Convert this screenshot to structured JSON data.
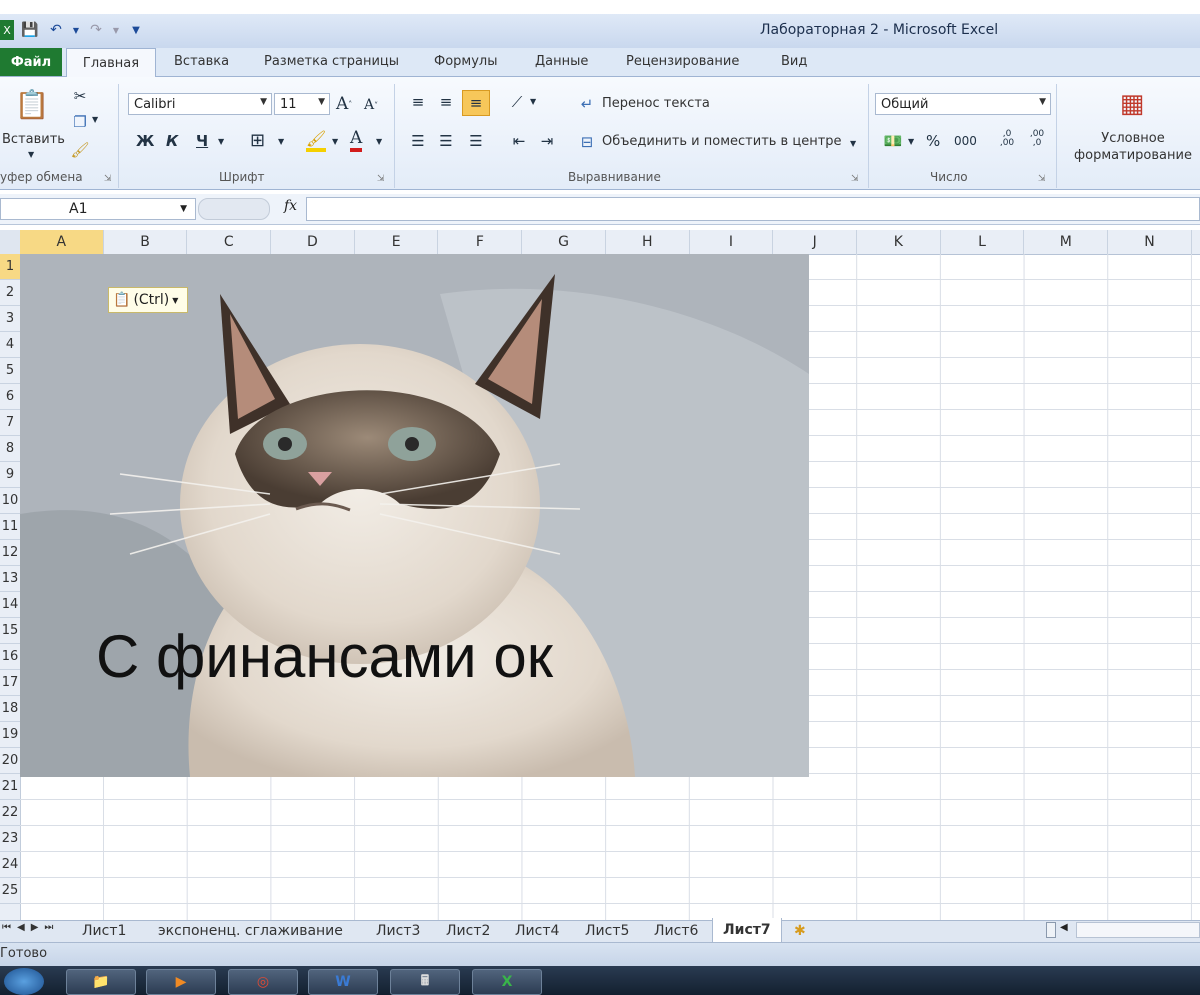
{
  "window": {
    "title": "Лабораторная 2  -  Microsoft Excel"
  },
  "ribbon_tabs": [
    "Файл",
    "Главная",
    "Вставка",
    "Разметка страницы",
    "Формулы",
    "Данные",
    "Рецензирование",
    "Вид"
  ],
  "clipboard": {
    "paste_label": "Вставить",
    "group_label": "уфер обмена"
  },
  "font": {
    "name": "Calibri",
    "size": "11",
    "bold": "Ж",
    "italic": "К",
    "underline": "Ч",
    "grow": "A",
    "shrink": "A",
    "font_color_glyph": "A",
    "group_label": "Шрифт"
  },
  "alignment": {
    "wrap_text": "Перенос текста",
    "merge_center": "Объединить и поместить в центре",
    "group_label": "Выравнивание"
  },
  "number": {
    "format": "Общий",
    "percent": "%",
    "thousands": "000",
    "inc_decimal": ",0 ,00",
    "dec_decimal": ",00 ,0",
    "group_label": "Число"
  },
  "styles": {
    "conditional_formatting": "Условное форматирование"
  },
  "formula_bar": {
    "name_box": "A1",
    "fx": "fx",
    "value": ""
  },
  "columns": [
    "A",
    "B",
    "C",
    "D",
    "E",
    "F",
    "G",
    "H",
    "I",
    "J",
    "K",
    "L",
    "M",
    "N"
  ],
  "rows": [
    "1",
    "2",
    "3",
    "4",
    "5",
    "6",
    "7",
    "8",
    "9",
    "10",
    "11",
    "12",
    "13",
    "14",
    "15",
    "16",
    "17",
    "18",
    "19",
    "20",
    "21",
    "22",
    "23",
    "24",
    "25"
  ],
  "selected_cell": "A1",
  "picture": {
    "caption": "С финансами ок",
    "paste_options": "(Ctrl)"
  },
  "sheets": [
    "Лист1",
    "экспоненц. сглаживание",
    "Лист3",
    "Лист2",
    "Лист4",
    "Лист5",
    "Лист6",
    "Лист7"
  ],
  "active_sheet": "Лист7",
  "status": {
    "ready": "Готово"
  },
  "colors": {
    "file_tab": "#1f7a31",
    "selection": "#f7c75a"
  }
}
